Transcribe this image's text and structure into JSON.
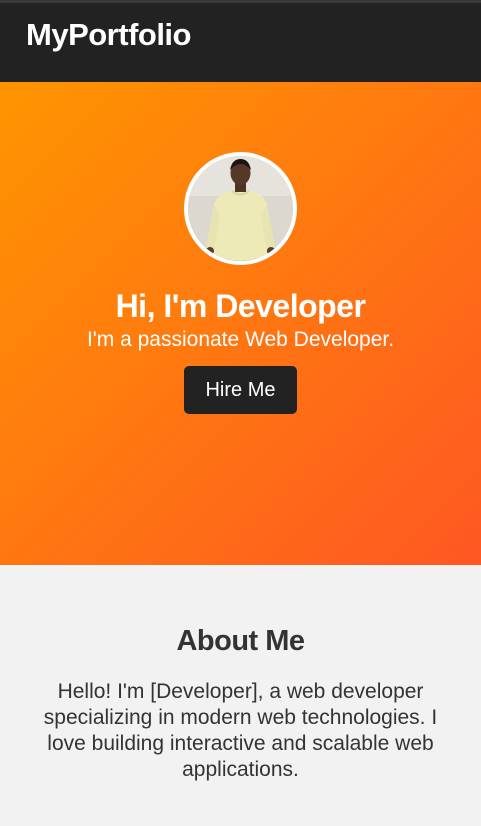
{
  "navbar": {
    "brand": "MyPortfolio"
  },
  "hero": {
    "title": "Hi, I'm Developer",
    "subtitle": "I'm a passionate Web Developer.",
    "cta_label": "Hire Me"
  },
  "about": {
    "title": "About Me",
    "text": "Hello! I'm [Developer], a web developer specializing in modern web technologies. I love building interactive and scalable web applications."
  },
  "colors": {
    "navbar_bg": "#222222",
    "hero_gradient_start": "#ff9500",
    "hero_gradient_end": "#ff5722",
    "button_bg": "#222222",
    "about_bg": "#f2f2f2",
    "text_dark": "#333333"
  }
}
